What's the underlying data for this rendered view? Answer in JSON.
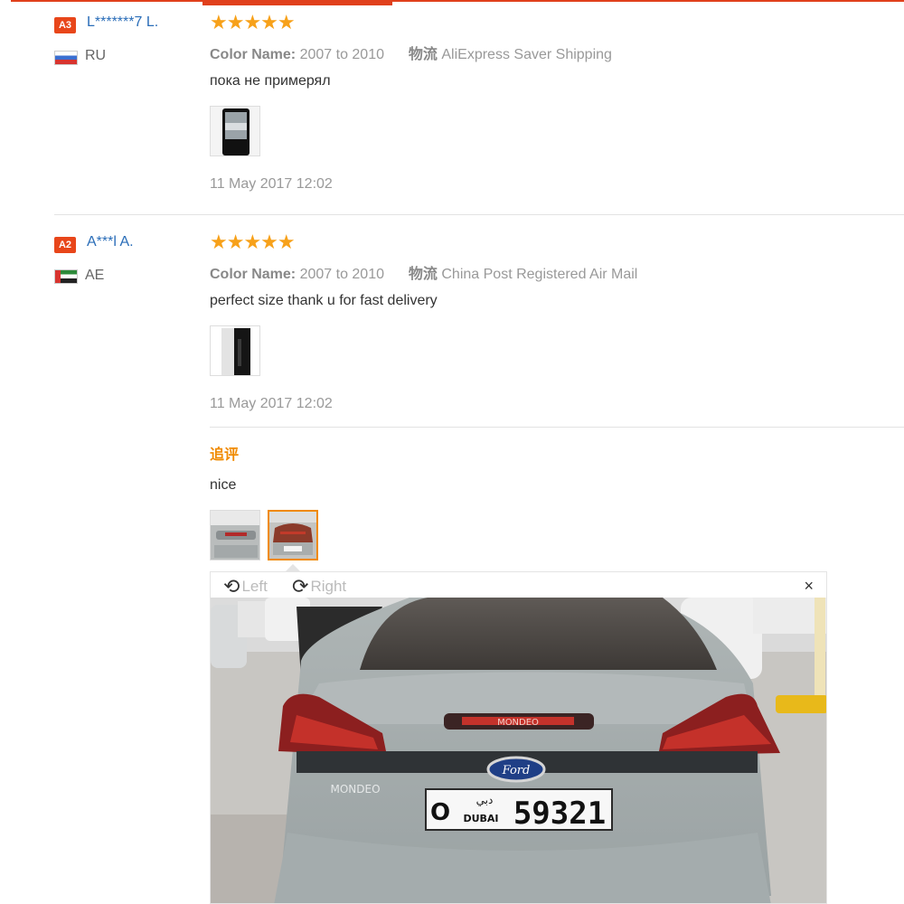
{
  "reviews": [
    {
      "badge": "A3",
      "username": "L*******7 L.",
      "country": "RU",
      "stars": "★★★★★",
      "color_label": "Color Name:",
      "color_value": "2007 to 2010",
      "shipping_label": "物流",
      "shipping_value": "AliExpress Saver Shipping",
      "text": "пока не примерял",
      "date": "11 May 2017 12:02"
    },
    {
      "badge": "A2",
      "username": "A***l A.",
      "country": "AE",
      "stars": "★★★★★",
      "color_label": "Color Name:",
      "color_value": "2007 to 2010",
      "shipping_label": "物流",
      "shipping_value": "China Post Registered Air Mail",
      "text": "perfect size thank u for fast delivery",
      "date": "11 May 2017 12:02",
      "followup_label": "追评",
      "followup_text": "nice"
    }
  ],
  "viewer": {
    "rotate_left": "Left",
    "rotate_right": "Right",
    "close": "×",
    "car_badge": "Ford",
    "car_model": "MONDEO",
    "brake_light": "MONDEO",
    "plate_letter": "O",
    "plate_city": "DUBAI",
    "plate_arabic": "دبي",
    "plate_number": "59321"
  },
  "colors": {
    "accent": "#e0401c",
    "star": "#f7a11a",
    "link": "#2a6db8",
    "followup": "#f08a00"
  }
}
